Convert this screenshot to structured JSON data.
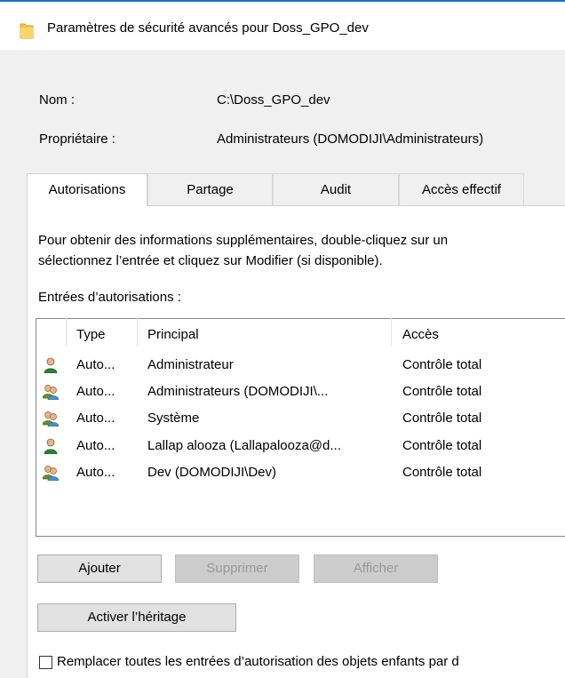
{
  "window": {
    "title": "Paramètres de sécurité avancés pour Doss_GPO_dev"
  },
  "info": {
    "name_label": "Nom :",
    "name_value": "C:\\Doss_GPO_dev",
    "owner_label": "Propriétaire :",
    "owner_value": "Administrateurs (DOMODIJI\\Administrateurs)"
  },
  "tabs": [
    {
      "label": "Autorisations",
      "active": true
    },
    {
      "label": "Partage",
      "active": false
    },
    {
      "label": "Audit",
      "active": false
    },
    {
      "label": "Accès effectif",
      "active": false
    }
  ],
  "description": {
    "line1": "Pour obtenir des informations supplémentaires, double-cliquez sur un",
    "line2": "sélectionnez l’entrée et cliquez sur Modifier (si disponible)."
  },
  "entries": {
    "label": "Entrées d’autorisations :",
    "columns": {
      "type": "Type",
      "principal": "Principal",
      "access": "Accès"
    },
    "rows": [
      {
        "icon": "user-icon",
        "type": "Auto...",
        "principal": "Administrateur",
        "access": "Contrôle total"
      },
      {
        "icon": "group-icon",
        "type": "Auto...",
        "principal": "Administrateurs (DOMODIJI\\...",
        "access": "Contrôle total"
      },
      {
        "icon": "group-icon",
        "type": "Auto...",
        "principal": "Système",
        "access": "Contrôle total"
      },
      {
        "icon": "user-icon",
        "type": "Auto...",
        "principal": "Lallap alooza (Lallapalooza@d...",
        "access": "Contrôle total"
      },
      {
        "icon": "group-icon",
        "type": "Auto...",
        "principal": "Dev (DOMODIJI\\Dev)",
        "access": "Contrôle total"
      }
    ]
  },
  "buttons": {
    "add": "Ajouter",
    "remove": "Supprimer",
    "view": "Afficher",
    "enable_inheritance": "Activer l’héritage"
  },
  "checkbox": {
    "label": "Remplacer toutes les entrées d’autorisation des objets enfants par d",
    "checked": false
  },
  "colors": {
    "accent": "#1a73c8",
    "folder": "#f4c542",
    "user_green": "#2e7d32"
  }
}
